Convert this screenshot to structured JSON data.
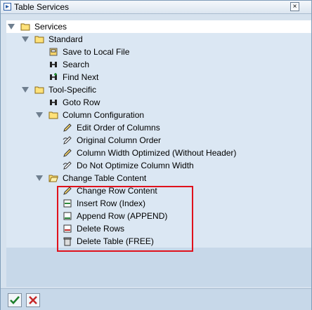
{
  "window": {
    "title": "Table Services"
  },
  "tree": {
    "root": "Services",
    "standard": {
      "label": "Standard",
      "items": [
        "Save to Local File",
        "Search",
        "Find Next"
      ]
    },
    "tool_specific": {
      "label": "Tool-Specific",
      "items": [
        "Goto Row"
      ]
    },
    "column_configuration": {
      "label": "Column Configuration",
      "items": [
        "Edit Order of Columns",
        "Original Column Order",
        "Column Width Optimized (Without Header)",
        "Do Not Optimize Column Width"
      ]
    },
    "change_table_content": {
      "label": "Change Table Content",
      "items": [
        "Change Row Content",
        "Insert Row (Index)",
        "Append Row (APPEND)",
        "Delete Rows",
        "Delete Table (FREE)"
      ]
    }
  }
}
